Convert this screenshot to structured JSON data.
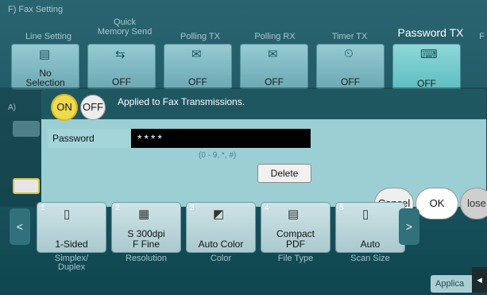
{
  "header": {
    "title": "F)  Fax Setting"
  },
  "tabs": [
    {
      "label": "Line Setting"
    },
    {
      "label": "Quick\nMemory Send"
    },
    {
      "label": "Polling TX"
    },
    {
      "label": "Polling RX"
    },
    {
      "label": "Timer TX"
    },
    {
      "label": "Password TX",
      "active": true
    },
    {
      "label": "F"
    }
  ],
  "function_buttons": [
    {
      "value": "No\nSelection",
      "icon": "line-setting-icon"
    },
    {
      "value": "OFF",
      "icon": "quick-memory-send-icon"
    },
    {
      "value": "OFF",
      "icon": "polling-tx-icon"
    },
    {
      "value": "OFF",
      "icon": "polling-rx-icon"
    },
    {
      "value": "OFF",
      "icon": "timer-tx-icon"
    },
    {
      "value": "OFF",
      "icon": "password-tx-icon"
    }
  ],
  "section_label": "A)",
  "dialog": {
    "on_label": "ON",
    "off_label": "OFF",
    "message": "Applied to Fax Transmissions.",
    "password_label": "Password",
    "password_value": "****",
    "password_hint": "(0 - 9, *, #)",
    "delete_label": "Delete"
  },
  "actions": {
    "cancel": "Cancel",
    "ok": "OK",
    "close": "lose"
  },
  "quick_settings": [
    {
      "num": "1",
      "value": "1-Sided",
      "caption": "Simplex/\nDuplex",
      "icon": "simplex-duplex-icon"
    },
    {
      "num": "2",
      "value": "S 300dpi\nF Fine",
      "caption": "Resolution",
      "icon": "resolution-icon"
    },
    {
      "num": "3",
      "value": "Auto Color",
      "caption": "Color",
      "icon": "color-icon"
    },
    {
      "num": "4",
      "value": "Compact\nPDF",
      "caption": "File Type",
      "icon": "file-type-icon"
    },
    {
      "num": "5",
      "value": "Auto",
      "caption": "Scan Size",
      "icon": "scan-size-icon"
    }
  ],
  "application_tab": "Applica",
  "colors": {
    "accent": "#f0d94c",
    "dialog": "#9bcfd4",
    "header": "#1f5761"
  }
}
